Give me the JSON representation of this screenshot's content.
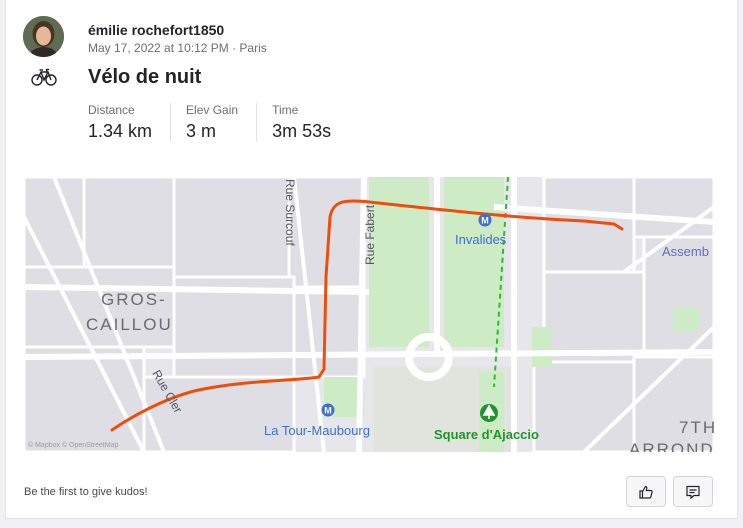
{
  "activity": {
    "athlete_name": "émilie rochefort1850",
    "date_location": "May 17, 2022 at 10:12 PM · Paris",
    "sport_icon": "bike-icon",
    "title": "Vélo de nuit"
  },
  "stats": [
    {
      "label": "Distance",
      "value": "1.34 km"
    },
    {
      "label": "Elev Gain",
      "value": "3 m"
    },
    {
      "label": "Time",
      "value": "3m 53s"
    }
  ],
  "map": {
    "labels": {
      "gros": "GROS-",
      "caillou": "CAILLOU",
      "rue_surcouf": "Rue Surcouf",
      "rue_fabert": "Rue Fabert",
      "rue_cler": "Rue Cler",
      "invalides": "Invalides",
      "la_tour_maubourg": "La Tour-Maubourg",
      "square_ajaccio": "Square d'Ajaccio",
      "assemb": "Assemb",
      "seventh": "7TH",
      "arrondis": "ARRONDIS"
    },
    "attribution": "© Mapbox © OpenStreetMap",
    "route_color": "#f04d0c",
    "metro_color": "#3e6fd1",
    "park_color": "#cdebc4",
    "park_label_color": "#23942d"
  },
  "footer": {
    "kudos_prompt": "Be the first to give kudos!",
    "kudos_icon": "thumbs-up-icon",
    "comment_icon": "comment-icon"
  }
}
